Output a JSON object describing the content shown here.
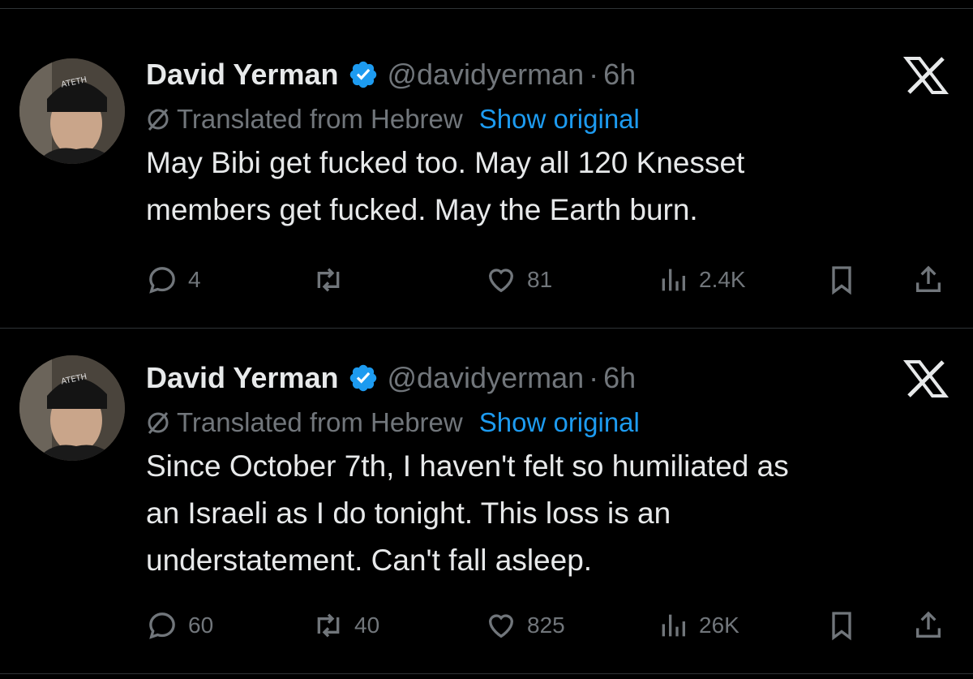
{
  "tweets": [
    {
      "author_name": "David Yerman",
      "handle": "@davidyerman",
      "separator": "·",
      "time": "6h",
      "translated_label": "Translated from Hebrew",
      "show_original": "Show original",
      "text_lines": [
        "May Bibi get fucked too. May all 120 Knesset",
        "members get fucked. May the Earth burn."
      ],
      "replies": "4",
      "retweets": "",
      "likes": "81",
      "views": "2.4K"
    },
    {
      "author_name": "David Yerman",
      "handle": "@davidyerman",
      "separator": "·",
      "time": "6h",
      "translated_label": "Translated from Hebrew",
      "show_original": "Show original",
      "text_lines": [
        "Since October 7th, I haven't felt so humiliated as",
        "an Israeli as I do tonight. This loss is an",
        "understatement. Can't fall asleep."
      ],
      "replies": "60",
      "retweets": "40",
      "likes": "825",
      "views": "26K"
    }
  ],
  "icons": {
    "verified": "verified-badge-icon",
    "x_logo": "x-logo-icon",
    "translate": "translate-icon",
    "reply": "reply-icon",
    "retweet": "retweet-icon",
    "like": "like-icon",
    "views": "views-icon",
    "bookmark": "bookmark-icon",
    "share": "share-icon"
  },
  "colors": {
    "background": "#000000",
    "text": "#e7e9ea",
    "muted": "#71767b",
    "accent": "#1d9bf0",
    "divider": "#2f3336"
  }
}
